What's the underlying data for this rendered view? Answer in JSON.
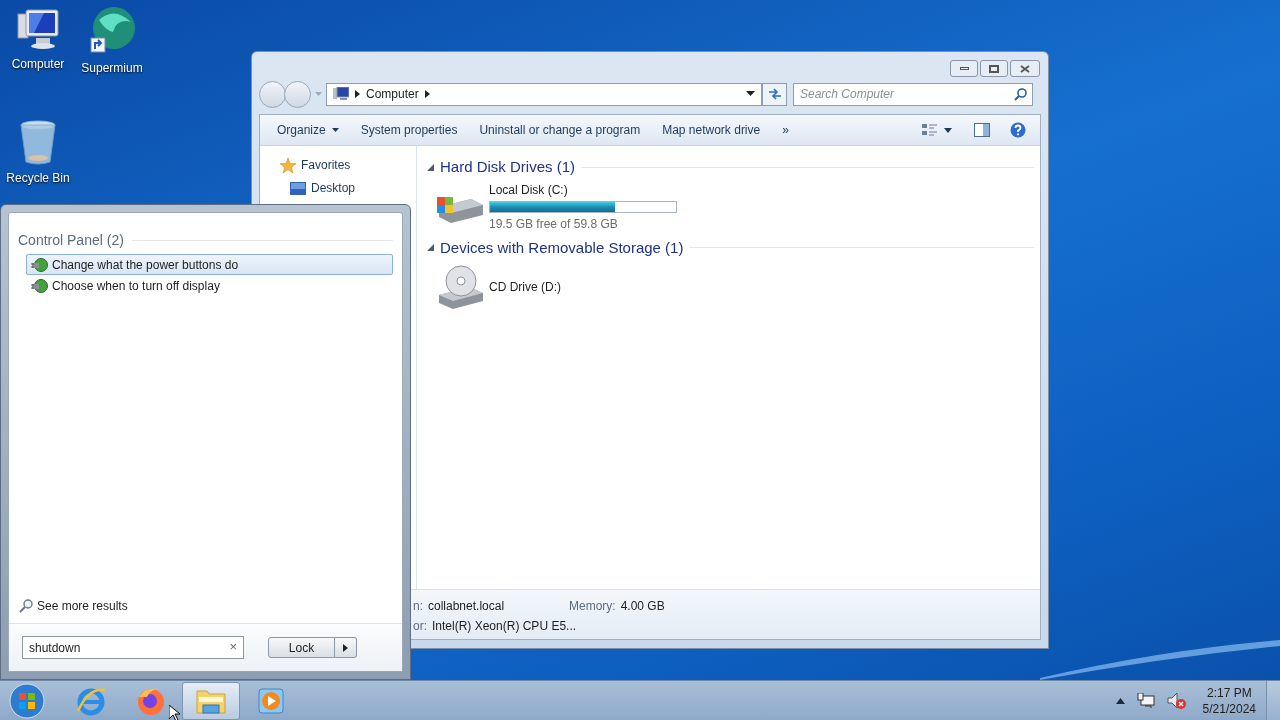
{
  "desktop_icons": [
    {
      "label": "Computer",
      "kind": "computer"
    },
    {
      "label": "Supermium",
      "kind": "browser"
    },
    {
      "label": "Recycle Bin",
      "kind": "bin"
    }
  ],
  "explorer": {
    "address": {
      "crumb": "Computer"
    },
    "search": {
      "placeholder": "Search Computer"
    },
    "toolbar": [
      {
        "label": "Organize",
        "kind": "menu"
      },
      {
        "label": "System properties",
        "kind": "plain"
      },
      {
        "label": "Uninstall or change a program",
        "kind": "plain"
      },
      {
        "label": "Map network drive",
        "kind": "plain"
      },
      {
        "label": "»",
        "kind": "plain"
      }
    ],
    "nav_pane": [
      {
        "label": "Favorites",
        "kind": "star"
      },
      {
        "label": "Desktop",
        "kind": "desktop"
      }
    ],
    "groups": [
      {
        "title": "Hard Disk Drives (1)",
        "items": [
          {
            "name": "Local Disk (C:)",
            "kind": "disk",
            "level": 0.67,
            "free": "19.5 GB free of 59.8 GB"
          }
        ]
      },
      {
        "title": "Devices with Removable Storage (1)",
        "items": [
          {
            "name": "CD Drive (D:)",
            "kind": "cd"
          }
        ]
      }
    ],
    "details": [
      {
        "label": "n:",
        "value": "collabnet.local"
      },
      {
        "label": "Memory:",
        "value": "4.00 GB"
      },
      {
        "label": "or:",
        "value": "Intel(R) Xeon(R) CPU E5..."
      }
    ]
  },
  "start_menu": {
    "section": "Control Panel (2)",
    "results": [
      {
        "label": "Change what the power buttons do",
        "selected": true
      },
      {
        "label": "Choose when to turn off display",
        "selected": false
      }
    ],
    "see_more": "See more results",
    "search": {
      "value": "shutdown",
      "clear": "×"
    },
    "power_button": "Lock"
  },
  "taskbar": {
    "apps": [
      {
        "kind": "ie",
        "selected": false
      },
      {
        "kind": "firefox",
        "selected": false
      },
      {
        "kind": "explorer",
        "selected": true
      },
      {
        "kind": "media",
        "selected": false
      }
    ],
    "clock": {
      "time": "2:17 PM",
      "date": "5/21/2024"
    }
  }
}
